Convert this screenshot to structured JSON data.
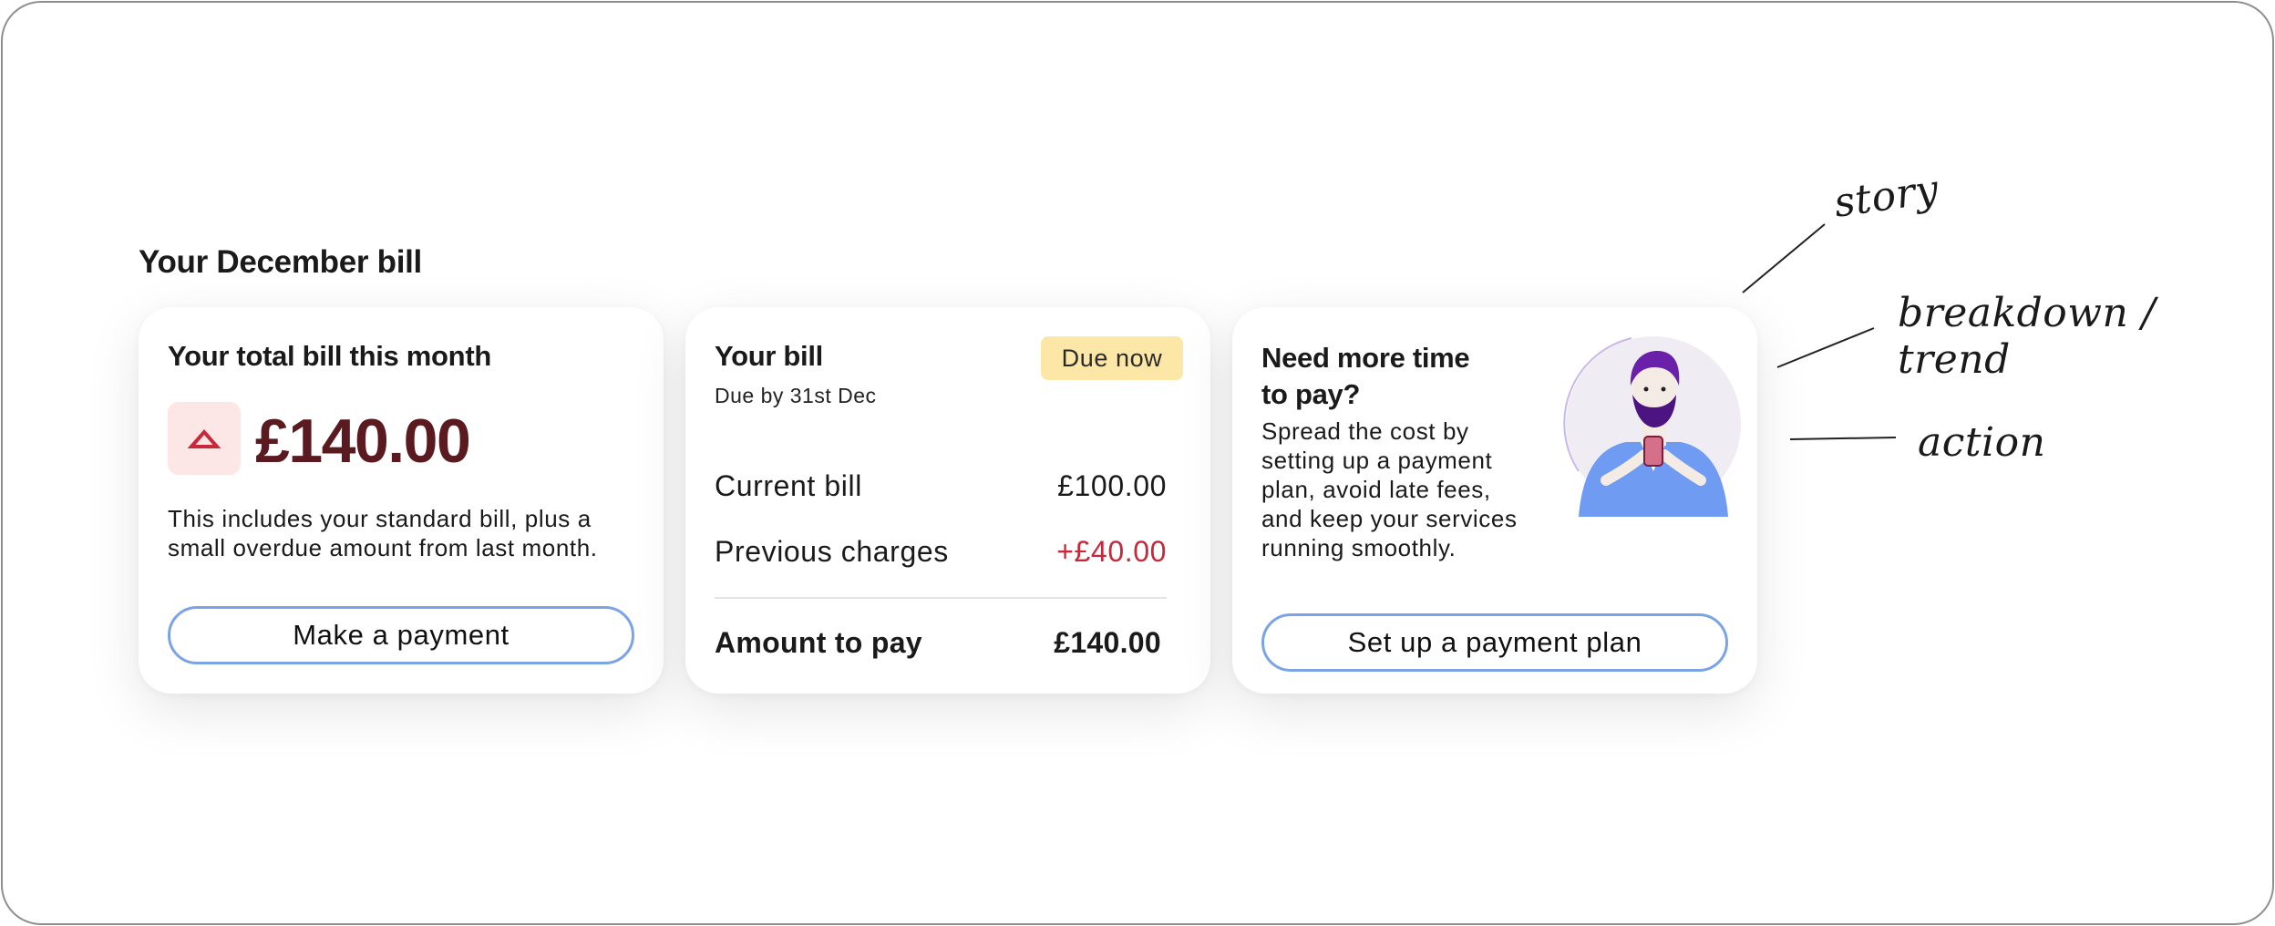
{
  "section": {
    "title": "Your December bill"
  },
  "total_card": {
    "title": "Your total bill this month",
    "trend_icon": "trend-up-icon",
    "amount": "£140.00",
    "description": "This includes your standard bill, plus a small overdue amount from last month.",
    "button": "Make a payment"
  },
  "bill_card": {
    "title": "Your bill",
    "due_date": "Due by 31st Dec",
    "badge": "Due now",
    "rows": [
      {
        "label": "Current bill",
        "value": "£100.00"
      },
      {
        "label": "Previous charges",
        "value": "+£40.00"
      }
    ],
    "total_label": "Amount to pay",
    "total_value": "£140.00"
  },
  "plan_card": {
    "title": "Need more time to pay?",
    "description": "Spread the cost by setting up a payment plan, avoid late fees, and keep your services running smoothly.",
    "illustration": "person-with-phone-illustration",
    "button": "Set up a payment plan"
  },
  "annotations": {
    "story": "story",
    "breakdown": "breakdown / trend",
    "action": "action"
  },
  "colors": {
    "amount": "#5a1a1f",
    "trend_bg": "#fde6e6",
    "trend_icon": "#c8283a",
    "badge_bg": "#fde7a6",
    "negative": "#c8283a",
    "button_border": "#7ba4e8"
  }
}
